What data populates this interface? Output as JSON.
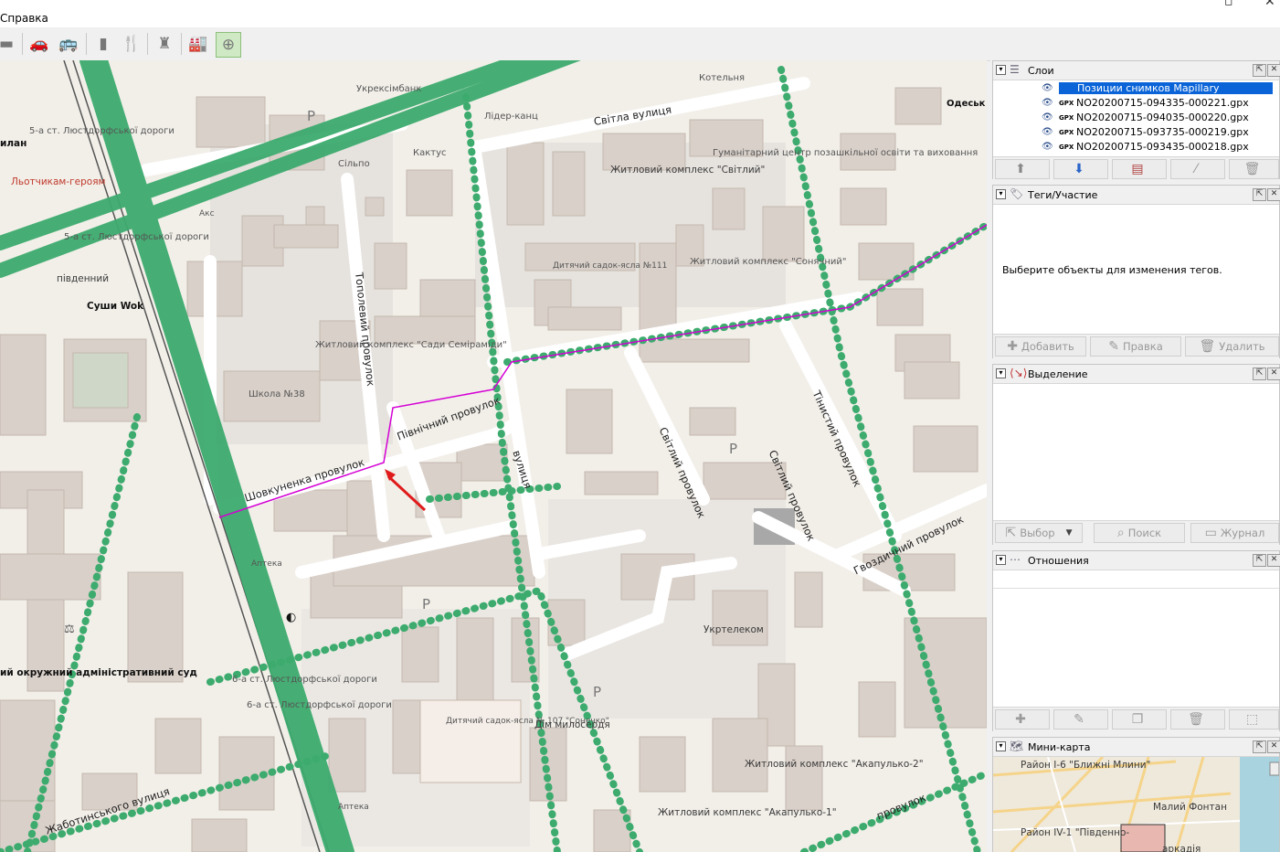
{
  "menubar": {
    "help_menu": "Справка"
  },
  "toolbar": {
    "icons": [
      "field-icon",
      "car-icon",
      "bus-icon",
      "barrier-icon",
      "restaurant-icon",
      "castle-icon",
      "factory-icon",
      "mapillary-icon"
    ]
  },
  "map": {
    "streets": {
      "svitla": "Світла вулиця",
      "topolevyi": "Тополевий провулок",
      "pivnichnyi": "Північний провулок",
      "shovkunenka": "Шовкуненка провулок",
      "svitlyi1": "Світлий провулок",
      "svitlyi2": "Світлий провулок",
      "tinystyi": "Тінистий провулок",
      "hvozdychnyi": "Гвоздичний провулок",
      "zhabotynskoho": "Жаботинського вулиця",
      "street_bottom_right": "провулок",
      "vertical_street": "вулиця"
    },
    "labels": {
      "zhk_svitlyi": "Житловий комплекс \"Світлий\"",
      "zhk_soniachnyi": "Житловий комплекс \"Сонячний\"",
      "zhk_sady": "Житловий комплекс \"Сади Семіраміди\"",
      "hum_center": "Гуманітарний центр позашкільної освіти та виховання",
      "kindergarten_111": "Дитячий садок-ясла №111",
      "kindergarten_107": "Дитячий садок-ясла № 107 \"Сонечко\"",
      "school": "Школа №38",
      "ukrtelekom": "Укртелеком",
      "dim_myloserdia": "Дім милосердя",
      "zhk_akapulko1": "Житловий комплекс \"Акапулько-1\"",
      "zhk_akapulko2": "Житловий комплекс \"Акапулько-2\"",
      "court": "ий окружний адміністративний суд",
      "sushi": "Суши Wok",
      "pivdennyi": "південний",
      "ukreksim": "Укрексімбанк",
      "silpo": "Сільпо",
      "kotelnia": "Котельня",
      "kaktus": "Кактус",
      "lider": "Лідер-канц",
      "apteka1": "Аптека",
      "apteka2": "Аптека",
      "aks": "Акс",
      "l_heroes": "Льотчикам-героям",
      "milan": "илан",
      "odesa": "Одеськ регіонал інстит держав управлі (ОРІД",
      "stop_5a": "5-а ст. Люстдорфської дороги",
      "stop_6a": "6-а ст. Люстдорфської дороги",
      "stop_5a_2": "5-а ст. Люстдорфської дороги",
      "stop_6a_2": "6-а ст. Люстдорфської дороги",
      "p1": "P",
      "p2": "P",
      "p3": "P",
      "p4": "P"
    }
  },
  "panels": {
    "layers": {
      "title": "Слои",
      "items": [
        {
          "name": "Позиции снимков Mapillary",
          "selected": true
        },
        {
          "name": "NO20200715-094335-000221.gpx"
        },
        {
          "name": "NO20200715-094035-000220.gpx"
        },
        {
          "name": "NO20200715-093735-000219.gpx"
        },
        {
          "name": "NO20200715-093435-000218.gpx"
        }
      ],
      "gpx_tag": "GPX"
    },
    "tags": {
      "title": "Теги/Участие",
      "empty_message": "Выберите объекты для изменения тегов.",
      "add": "Добавить",
      "edit": "Правка",
      "delete": "Удалить"
    },
    "selection": {
      "title": "Выделение",
      "select": "Выбор",
      "search": "Поиск",
      "history": "Журнал"
    },
    "relations": {
      "title": "Отношения"
    },
    "minimap": {
      "title": "Мини-карта",
      "labels": {
        "r1": "Район I-6 \"Ближні Млини\"",
        "r2": "Район IV-1 \"Південно-",
        "r3": "Малий Фонтан",
        "r4": "аркадія"
      }
    }
  },
  "colors": {
    "gps_track": "#3dab6e",
    "route": "#d400d4",
    "selection": "#0a64d8",
    "arrow": "#e01b1b"
  }
}
